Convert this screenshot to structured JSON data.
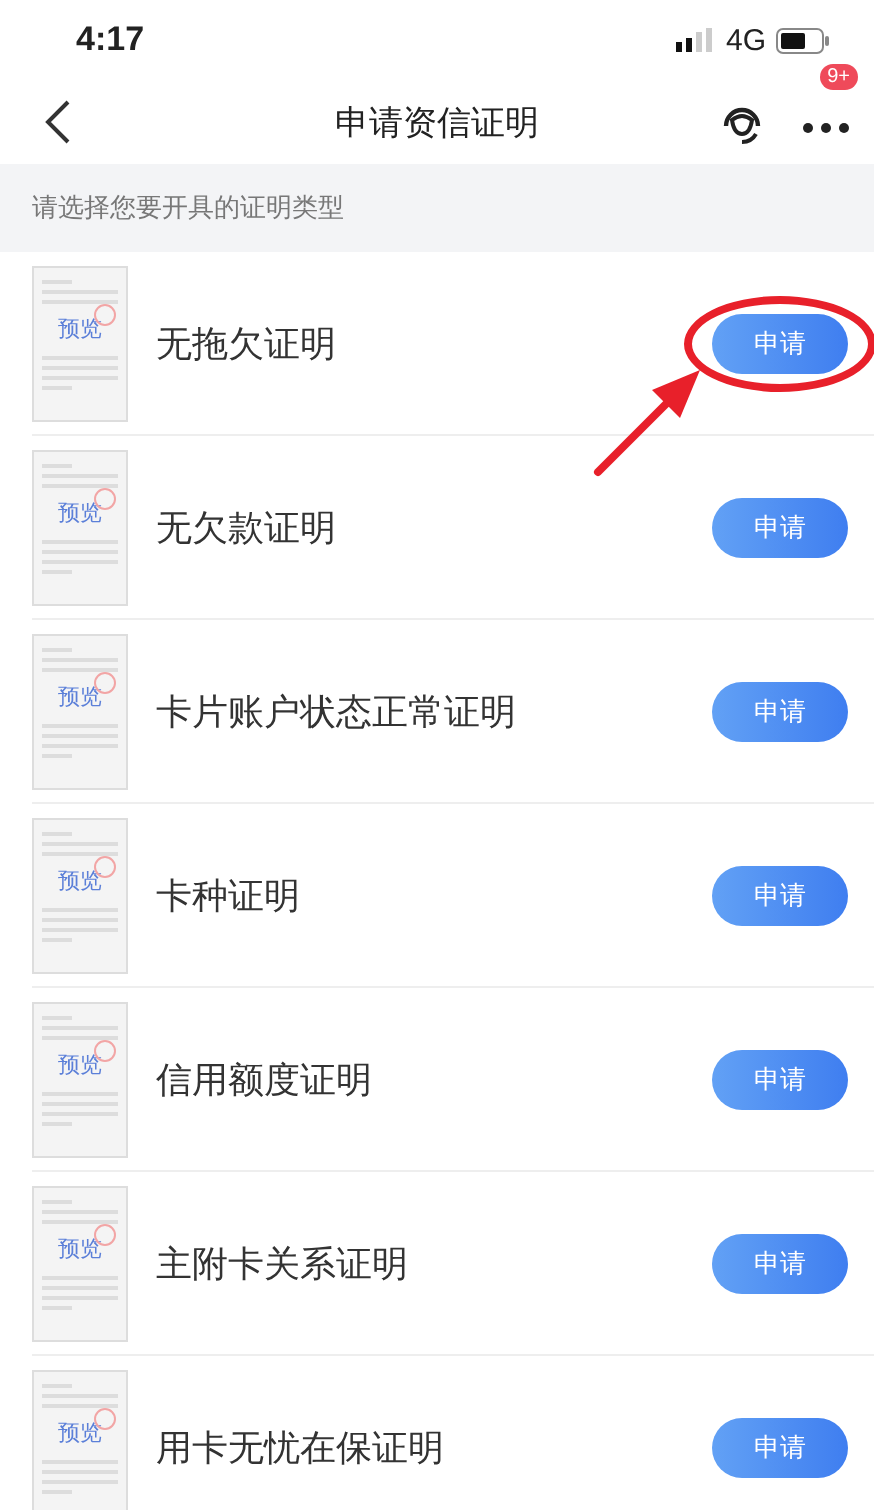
{
  "status_bar": {
    "time": "4:17",
    "network": "4G"
  },
  "nav": {
    "title": "申请资信证明",
    "badge": "9+"
  },
  "hint": "请选择您要开具的证明类型",
  "items": [
    {
      "title": "无拖欠证明",
      "preview_label": "预览",
      "button": "申请",
      "highlighted": true
    },
    {
      "title": "无欠款证明",
      "preview_label": "预览",
      "button": "申请",
      "highlighted": false
    },
    {
      "title": "卡片账户状态正常证明",
      "preview_label": "预览",
      "button": "申请",
      "highlighted": false
    },
    {
      "title": "卡种证明",
      "preview_label": "预览",
      "button": "申请",
      "highlighted": false
    },
    {
      "title": "信用额度证明",
      "preview_label": "预览",
      "button": "申请",
      "highlighted": false
    },
    {
      "title": "主附卡关系证明",
      "preview_label": "预览",
      "button": "申请",
      "highlighted": false
    },
    {
      "title": "用卡无忧在保证明",
      "preview_label": "预览",
      "button": "申请",
      "highlighted": false
    }
  ]
}
